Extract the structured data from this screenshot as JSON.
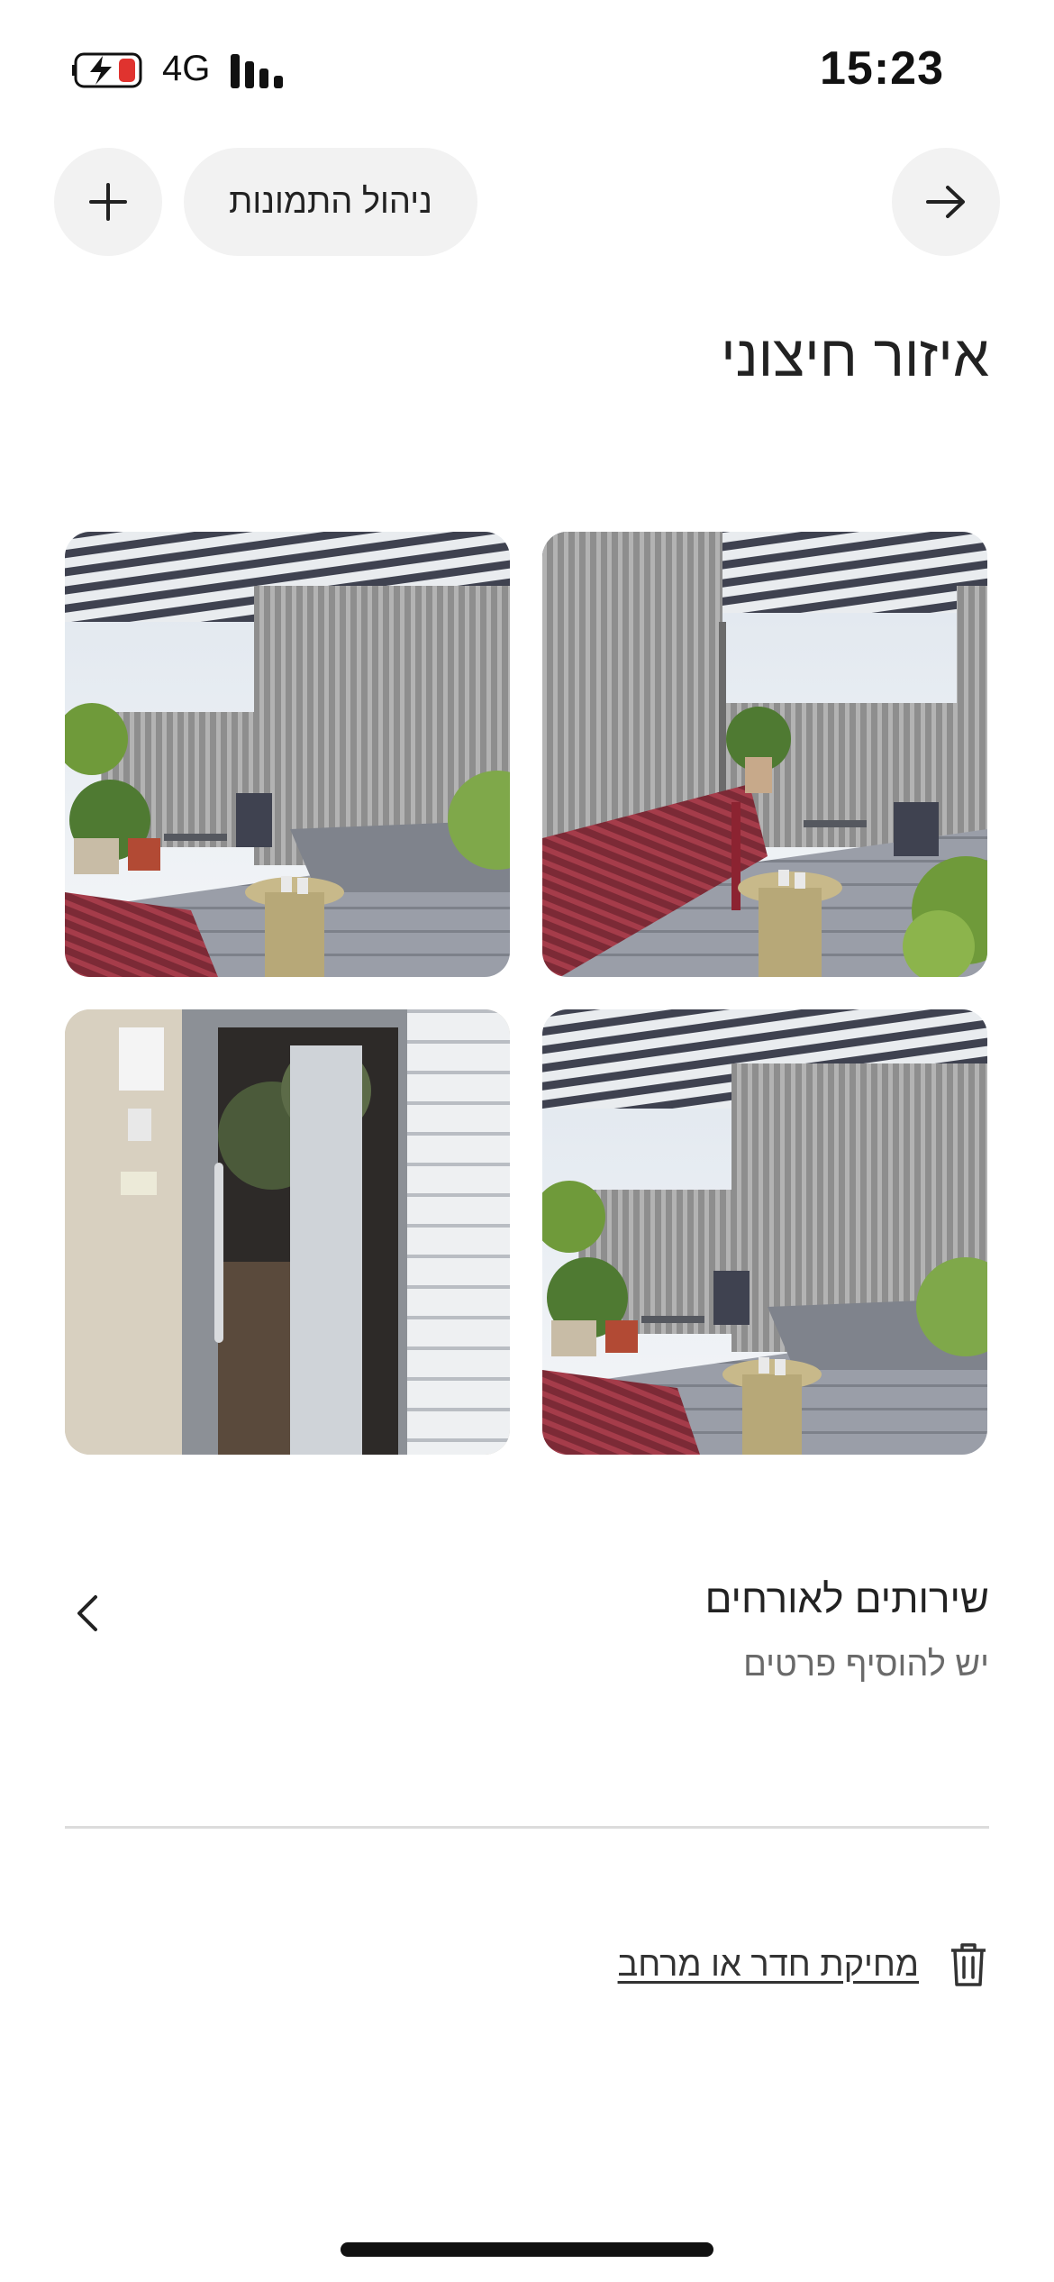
{
  "status_bar": {
    "network": "4G",
    "time": "15:23"
  },
  "header": {
    "add_icon": "plus-icon",
    "manage_photos_label": "ניהול התמונות",
    "next_icon": "arrow-right-icon"
  },
  "page": {
    "title": "איזור חיצוני"
  },
  "photos": [
    {
      "name": "terrace-red-bench"
    },
    {
      "name": "terrace-pergola"
    },
    {
      "name": "terrace-wide"
    },
    {
      "name": "entrance-door"
    }
  ],
  "section": {
    "title": "שירותים לאורחים",
    "subtitle": "יש להוסיף פרטים",
    "chevron_icon": "chevron-left-icon"
  },
  "delete": {
    "label": "מחיקת חדר או מרחב",
    "icon": "trash-icon"
  }
}
